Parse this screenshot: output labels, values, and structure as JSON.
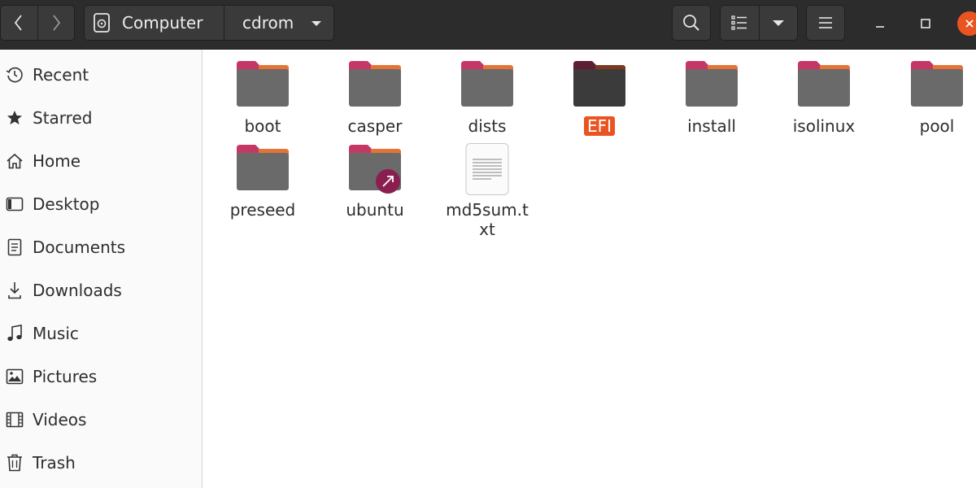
{
  "header": {
    "breadcrumbs": [
      "Computer",
      "cdrom"
    ]
  },
  "sidebar": {
    "items": [
      {
        "label": "Recent",
        "icon": "clock-icon"
      },
      {
        "label": "Starred",
        "icon": "star-icon"
      },
      {
        "label": "Home",
        "icon": "home-icon"
      },
      {
        "label": "Desktop",
        "icon": "desktop-icon"
      },
      {
        "label": "Documents",
        "icon": "document-icon"
      },
      {
        "label": "Downloads",
        "icon": "download-icon"
      },
      {
        "label": "Music",
        "icon": "music-icon"
      },
      {
        "label": "Pictures",
        "icon": "picture-icon"
      },
      {
        "label": "Videos",
        "icon": "video-icon"
      },
      {
        "label": "Trash",
        "icon": "trash-icon"
      }
    ]
  },
  "files": [
    {
      "name": "boot",
      "kind": "folder"
    },
    {
      "name": "casper",
      "kind": "folder"
    },
    {
      "name": "dists",
      "kind": "folder"
    },
    {
      "name": "EFI",
      "kind": "folder",
      "selected": true
    },
    {
      "name": "install",
      "kind": "folder"
    },
    {
      "name": "isolinux",
      "kind": "folder"
    },
    {
      "name": "pool",
      "kind": "folder"
    },
    {
      "name": "preseed",
      "kind": "folder"
    },
    {
      "name": "ubuntu",
      "kind": "folder-link"
    },
    {
      "name": "md5sum.txt",
      "kind": "text-file"
    }
  ],
  "colors": {
    "accent": "#e95420",
    "folder_tab": "#c53865",
    "folder_body": "#6a6a6a",
    "headerbar": "#2c2c2c"
  }
}
